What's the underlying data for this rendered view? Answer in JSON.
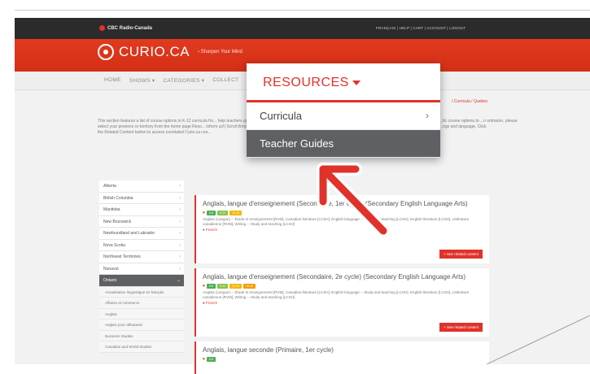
{
  "header": {
    "cbc_label": "CBC  Radio-Canada",
    "top_links": "FRANÇAIS  |  HELP  |  CART  |  ACCOUNT  |  LOGOUT"
  },
  "brand": {
    "logo_text": "CURIO.CA",
    "tagline": "› Sharpen Your Mind"
  },
  "nav": {
    "home": "HOME",
    "shows": "SHOWS ▾",
    "categories": "CATEGORIES ▾",
    "collections": "COLLECT",
    "right": "W?"
  },
  "breadcrumb": "/ Curricula / Quebec",
  "intro": {
    "left": "This section features a list of course options in K-12 curricula fro... help teachers quickly identify the content they seek. Simply select your province or territory from the home page Reso... inform us!) Scroll through the list or select a course from the drop... on the Related Content button to access correlated Curio.ca con...",
    "right": "...fic course options to ...n omission, please ...ngs and language. Click"
  },
  "sidebar": {
    "items": [
      {
        "label": "Alberta"
      },
      {
        "label": "British Columbia"
      },
      {
        "label": "Manitoba"
      },
      {
        "label": "New Brunswick"
      },
      {
        "label": "Newfoundland and Labrador"
      },
      {
        "label": "Nova Scotia"
      },
      {
        "label": "Northwest Territories"
      },
      {
        "label": "Nunavut"
      },
      {
        "label": "Ontario"
      }
    ],
    "subitems": [
      {
        "label": "Actualisation linguistique en français"
      },
      {
        "label": "Affaires et commerce"
      },
      {
        "label": "Anglais"
      },
      {
        "label": "Anglais pour débutants"
      },
      {
        "label": "Business Studies"
      },
      {
        "label": "Canadian and World Studies"
      }
    ]
  },
  "courses": [
    {
      "title": "Anglais, langue d'enseignement (Secondaire, 1er cycle) (Secondary English Language Arts)",
      "badges": [
        "5-8",
        "9-12",
        "13-18"
      ],
      "subjects": "Anglais (Langue) -- Étude et enseignement [RVM], Canadian literature [LCSH], English language -- Study and teaching [LCSH], English literature [LCSH], Littérature canadienne [RVM], Writing -- Study and teaching [LCSH]",
      "language": "French",
      "related": "+ See related content"
    },
    {
      "title": "Anglais, langue d'enseignement (Secondaire, 2e cycle) (Secondary English Language Arts)",
      "badges": [
        "5-8",
        "9-12",
        "13-16",
        "16-18"
      ],
      "subjects": "Anglais (Langue) -- Étude et enseignement [RVM], Canadian literature [LCSH], English language -- Study and teaching [LCSH], English literature [LCSH], Littérature canadienne [RVM], Writing -- Study and teaching [LCSH]",
      "language": "French",
      "related": "+ See related content"
    },
    {
      "title": "Anglais, langue seconde (Primaire, 1er cycle)",
      "badges": [
        "5-8"
      ]
    }
  ],
  "dropdown": {
    "title": "RESOURCES",
    "items": [
      {
        "label": "Curricula"
      },
      {
        "label": "Teacher Guides"
      }
    ]
  },
  "colors": {
    "brand_red": "#e0322a",
    "highlight_gray": "#5f6063"
  }
}
